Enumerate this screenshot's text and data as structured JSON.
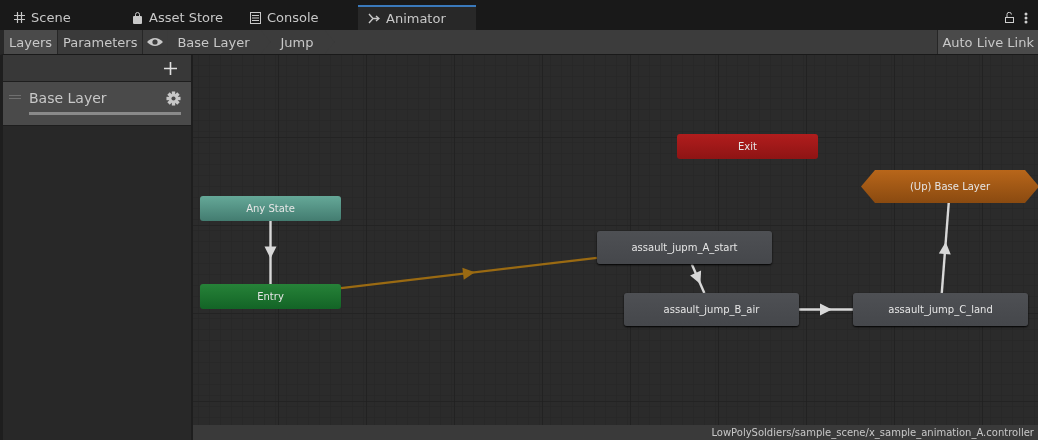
{
  "tabs": [
    {
      "label": "Scene",
      "selected": false
    },
    {
      "label": "Asset Store",
      "selected": false
    },
    {
      "label": "Console",
      "selected": false
    },
    {
      "label": "Animator",
      "selected": true
    }
  ],
  "toolbar": {
    "panels": [
      {
        "label": "Layers",
        "selected": true
      },
      {
        "label": "Parameters",
        "selected": false
      }
    ],
    "breadcrumb": [
      "Base Layer",
      "Jump"
    ],
    "auto_live_link": {
      "label": "Auto Live Link",
      "on": false
    }
  },
  "layers": [
    {
      "name": "Base Layer",
      "selected": true,
      "level": 1
    }
  ],
  "graph": {
    "nodes": [
      {
        "kind": "exit",
        "label": "Exit"
      },
      {
        "kind": "any",
        "label": "Any State"
      },
      {
        "kind": "entry",
        "label": "Entry"
      },
      {
        "kind": "up",
        "label": "(Up) Base Layer"
      },
      {
        "kind": "state",
        "label": "assault_jupm_A_start"
      },
      {
        "kind": "state",
        "label": "assault_jump_B_air"
      },
      {
        "kind": "state",
        "label": "assault_jump_C_land"
      }
    ]
  },
  "status_bar": {
    "path": "LowPolySoldiers/sample_scene/x_sample_animation_A.controller"
  }
}
